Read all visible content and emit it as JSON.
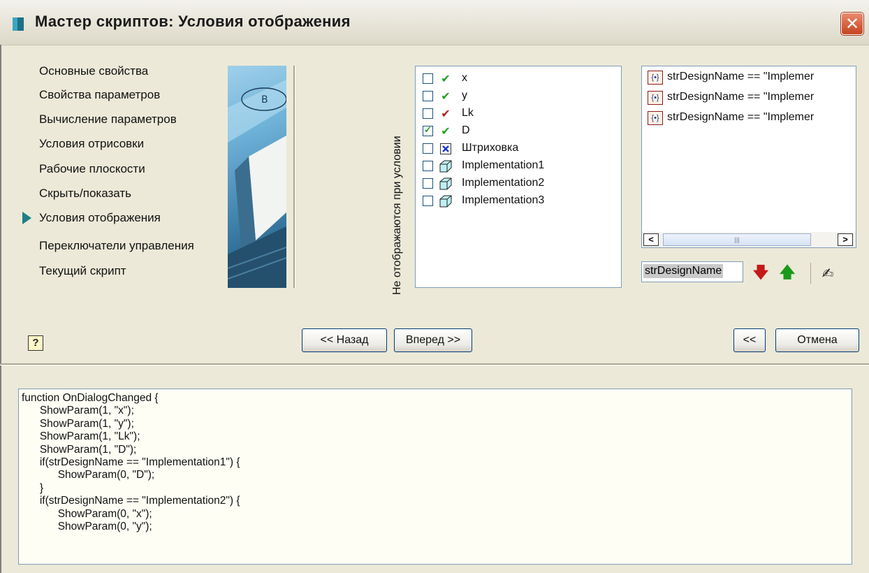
{
  "window": {
    "title": "Мастер скриптов:  Условия отображения",
    "close_label": "✕"
  },
  "nav": {
    "items": [
      {
        "label": "Основные свойства",
        "current": false
      },
      {
        "label": "Свойства параметров",
        "current": false
      },
      {
        "label": "Вычисление параметров",
        "current": false
      },
      {
        "label": "Условия отрисовки",
        "current": false
      },
      {
        "label": "Рабочие плоскости",
        "current": false
      },
      {
        "label": "Скрыть/показать",
        "current": false
      },
      {
        "label": "Условия отображения",
        "current": true
      },
      {
        "label": "Переключатели управления",
        "current": false
      },
      {
        "label": "Текущий скрипт",
        "current": false
      }
    ]
  },
  "hidden_label": "Не отображаются при условии",
  "params": [
    {
      "label": "x",
      "checked": false,
      "icon": "green-check-icon"
    },
    {
      "label": "y",
      "checked": false,
      "icon": "green-check-icon"
    },
    {
      "label": "Lk",
      "checked": false,
      "icon": "red-check-icon"
    },
    {
      "label": "D",
      "checked": true,
      "icon": "green-check-icon"
    },
    {
      "label": "Штриховка",
      "checked": false,
      "icon": "hatch-x-icon"
    },
    {
      "label": "Implementation1",
      "checked": false,
      "icon": "cube-icon"
    },
    {
      "label": "Implementation2",
      "checked": false,
      "icon": "cube-icon"
    },
    {
      "label": "Implementation3",
      "checked": false,
      "icon": "cube-icon"
    }
  ],
  "conditions": [
    {
      "text": "strDesignName == \"Implemer"
    },
    {
      "text": "strDesignName == \"Implemer"
    },
    {
      "text": "strDesignName == \"Implemer"
    }
  ],
  "variable_field": "strDesignName",
  "buttons": {
    "back": "<< Назад",
    "next": "Вперед >>",
    "collapse": "<<",
    "cancel": "Отмена"
  },
  "help_label": "?",
  "code": "function OnDialogChanged {\n\tShowParam(1, \"x\");\n\tShowParam(1, \"y\");\n\tShowParam(1, \"Lk\");\n\tShowParam(1, \"D\");\n\tif(strDesignName == \"Implementation1\") {\n\t\tShowParam(0, \"D\");\n\t}\n\tif(strDesignName == \"Implementation2\") {\n\t\tShowParam(0, \"x\");\n\t\tShowParam(0, \"y\");",
  "colors": {
    "accent": "#1f7e86",
    "close": "#c6441f"
  }
}
